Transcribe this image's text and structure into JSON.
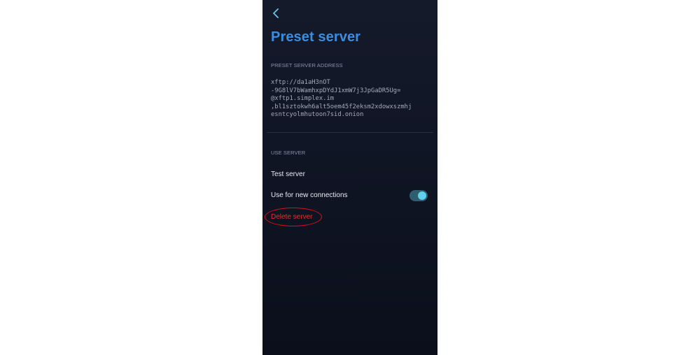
{
  "header": {
    "back_icon": "chevron-left-icon",
    "title": "Preset server"
  },
  "address_section": {
    "label": "PRESET SERVER ADDRESS",
    "lines": [
      "xftp://da1aH3nOT",
      "-9G8lV7bWamhxpDYdJ1xmW7j3JpGaDR5Ug=",
      "@xftp1.simplex.im",
      ",bl1sztokwh6alt5oem45f2eksm2xdowxszmhj",
      "esntcyolmhutoon7sid.onion"
    ]
  },
  "use_section": {
    "label": "USE SERVER",
    "test_server": "Test server",
    "use_for_new": "Use for new connections",
    "toggle_on": true,
    "delete_server": "Delete server"
  },
  "colors": {
    "title": "#3b8de0",
    "delete": "#e5302b",
    "toggle_knob": "#5fd1ee",
    "annotation": "#e01010"
  }
}
